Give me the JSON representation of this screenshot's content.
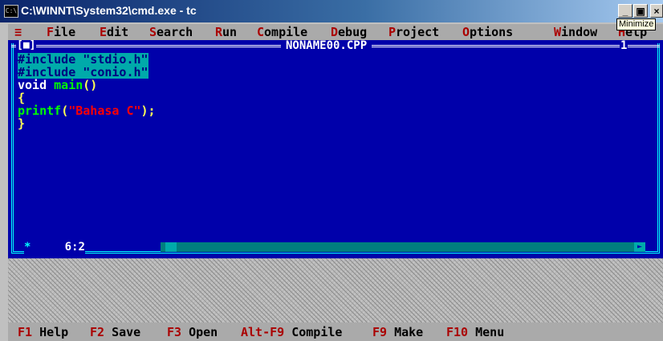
{
  "window": {
    "title": "C:\\WINNT\\System32\\cmd.exe - tc",
    "icon": "console-icon",
    "buttons": {
      "minimize": "_",
      "maximize": "8",
      "close": "×"
    },
    "tooltip": "Minimize"
  },
  "menubar": {
    "system": "≡",
    "items": [
      {
        "hotkey": "F",
        "rest": "ile"
      },
      {
        "hotkey": "E",
        "rest": "dit"
      },
      {
        "hotkey": "S",
        "rest": "earch"
      },
      {
        "hotkey": "R",
        "rest": "un"
      },
      {
        "hotkey": "C",
        "rest": "ompile"
      },
      {
        "hotkey": "D",
        "rest": "ebug"
      },
      {
        "hotkey": "P",
        "rest": "roject"
      },
      {
        "hotkey": "O",
        "rest": "ptions"
      },
      {
        "hotkey": "W",
        "rest": "indow"
      },
      {
        "hotkey": "H",
        "rest": "elp"
      }
    ]
  },
  "editor": {
    "close_box": "[■]",
    "filename": "NONAME00.CPP",
    "window_number": "1",
    "cursor_position": "6:2",
    "code": {
      "line1": "#include \"stdio.h\"",
      "line2": "#include \"conio.h\"",
      "line3_kw": "void ",
      "line3_fn": "main",
      "line3_paren": "()",
      "line4": "{",
      "line5_fn": "printf",
      "line5_open": "(",
      "line5_str": "\"Bahasa C\"",
      "line5_close": ");",
      "line6": "}"
    }
  },
  "statusbar": {
    "items": [
      {
        "key": "F1",
        "label": " Help"
      },
      {
        "key": "F2",
        "label": " Save"
      },
      {
        "key": "F3",
        "label": " Open"
      },
      {
        "key": "Alt-F9",
        "label": " Compile"
      },
      {
        "key": "F9",
        "label": " Make"
      },
      {
        "key": "F10",
        "label": " Menu"
      }
    ]
  },
  "colors": {
    "editor_bg": "#0000aa",
    "menu_bg": "#aaaaaa",
    "hotkey": "#aa0000",
    "selection": "#00aaaa",
    "string": "#ff0000"
  }
}
